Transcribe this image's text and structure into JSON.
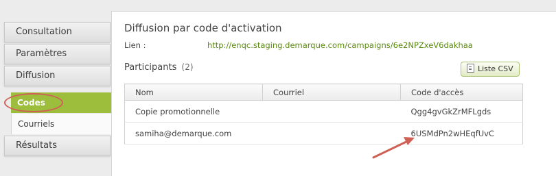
{
  "sidebar": {
    "items": [
      {
        "label": "Consultation"
      },
      {
        "label": "Paramètres"
      },
      {
        "label": "Diffusion"
      },
      {
        "label": "Résultats"
      }
    ],
    "subitems": [
      {
        "label": "Codes",
        "active": true
      },
      {
        "label": "Courriels",
        "active": false
      }
    ]
  },
  "main": {
    "title": "Diffusion par code d'activation",
    "link_label": "Lien :",
    "link_value": "http://enqc.staging.demarque.com/campaigns/6e2NPZxeV6dakhaa",
    "participants_label": "Participants",
    "participants_count": "(2)",
    "csv_button_label": "Liste CSV",
    "table": {
      "columns": [
        "Nom",
        "Courriel",
        "Code d'accès"
      ],
      "rows": [
        [
          "Copie promotionnelle",
          "",
          "Qgg4gvGkZrMFLgds"
        ],
        [
          "samiha@demarque.com",
          "",
          "6USMdPn2wHEqfUvC"
        ]
      ]
    }
  },
  "colors": {
    "accent_green": "#9dbd3c",
    "link_green": "#5a8a10",
    "annotation_red": "#d06055"
  },
  "icons": [
    "document-icon",
    "annotation-arrow-icon"
  ]
}
